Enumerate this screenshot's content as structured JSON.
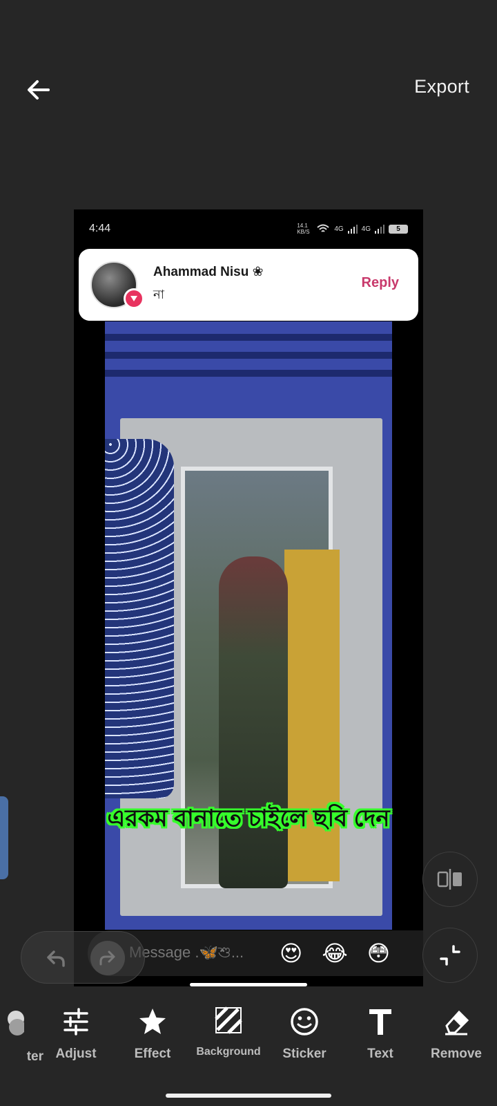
{
  "header": {
    "back_icon": "arrow-left-icon",
    "export_label": "Export"
  },
  "canvas": {
    "status": {
      "time": "4:44",
      "speed": "14.1 KB/S",
      "net1": "4G",
      "net2": "4G",
      "battery": "5"
    },
    "notification": {
      "name": "Ahammad Nisu ❀",
      "message": "না",
      "reply_label": "Reply"
    },
    "caption": "এরকম বানাতে চাইলে ছবি দেন",
    "message_bar": {
      "placeholder": "Message .🦋শু...",
      "emojis": [
        "😍",
        "😂",
        "😳"
      ]
    }
  },
  "toolbar": {
    "items": [
      {
        "label": "ter",
        "icon": "filter-icon"
      },
      {
        "label": "Adjust",
        "icon": "adjust-icon"
      },
      {
        "label": "Effect",
        "icon": "star-icon"
      },
      {
        "label": "Background",
        "icon": "background-icon"
      },
      {
        "label": "Sticker",
        "icon": "smiley-icon"
      },
      {
        "label": "Text",
        "icon": "text-icon"
      },
      {
        "label": "Remove",
        "icon": "eraser-icon"
      }
    ]
  },
  "colors": {
    "background": "#262626",
    "caption_outline": "#36ff2c",
    "reply": "#c8396b",
    "badge": "#e8335f"
  }
}
